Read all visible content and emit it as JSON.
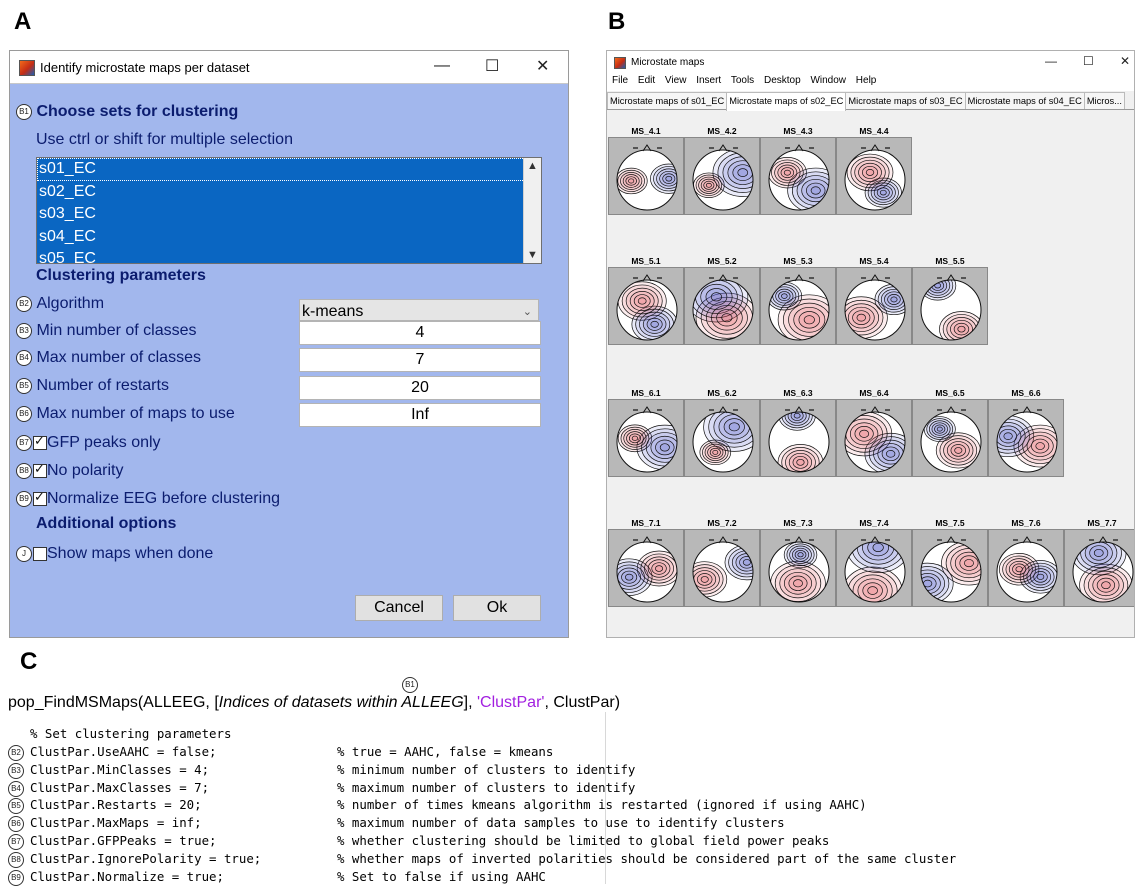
{
  "panels": {
    "a": "A",
    "b": "B",
    "c": "C"
  },
  "dialog_a": {
    "title": "Identify microstate maps per dataset",
    "window_buttons": {
      "minimize": "—",
      "maximize": "☐",
      "close": "✕"
    },
    "choose_sets_heading": "Choose sets for clustering",
    "choose_sets_badge": "B1",
    "hint": "Use ctrl or shift for multiple selection",
    "datasets": [
      "s01_EC",
      "s02_EC",
      "s03_EC",
      "s04_EC",
      "s05_EC"
    ],
    "clustering_heading": "Clustering parameters",
    "algorithm": {
      "badge": "B2",
      "label": "Algorithm",
      "value": "k-means"
    },
    "min_classes": {
      "badge": "B3",
      "label": "Min number of classes",
      "value": "4"
    },
    "max_classes": {
      "badge": "B4",
      "label": "Max number of classes",
      "value": "7"
    },
    "restarts": {
      "badge": "B5",
      "label": "Number of restarts",
      "value": "20"
    },
    "max_maps": {
      "badge": "B6",
      "label": "Max number of maps to use",
      "value": "Inf"
    },
    "gfp_peaks": {
      "badge": "B7",
      "label": "GFP peaks only",
      "checked": true
    },
    "no_polarity": {
      "badge": "B8",
      "label": "No polarity",
      "checked": true
    },
    "normalize": {
      "badge": "B9",
      "label": "Normalize EEG before clustering",
      "checked": true
    },
    "additional_heading": "Additional options",
    "show_maps": {
      "badge": "J",
      "label": "Show maps when done",
      "checked": false
    },
    "cancel_label": "Cancel",
    "ok_label": "Ok"
  },
  "window_b": {
    "title": "Microstate maps",
    "window_buttons": {
      "minimize": "—",
      "maximize": "☐",
      "close": "✕"
    },
    "menu": [
      "File",
      "Edit",
      "View",
      "Insert",
      "Tools",
      "Desktop",
      "Window",
      "Help"
    ],
    "tabs": [
      "Microstate maps of s01_EC",
      "Microstate maps of s02_EC",
      "Microstate maps of s03_EC",
      "Microstate maps of s04_EC",
      "Micros..."
    ],
    "active_tab": 1,
    "rows": [
      {
        "maps": [
          "MS_4.1",
          "MS_4.2",
          "MS_4.3",
          "MS_4.4"
        ]
      },
      {
        "maps": [
          "MS_5.1",
          "MS_5.2",
          "MS_5.3",
          "MS_5.4",
          "MS_5.5"
        ]
      },
      {
        "maps": [
          "MS_6.1",
          "MS_6.2",
          "MS_6.3",
          "MS_6.4",
          "MS_6.5",
          "MS_6.6"
        ]
      },
      {
        "maps": [
          "MS_7.1",
          "MS_7.2",
          "MS_7.3",
          "MS_7.4",
          "MS_7.5",
          "MS_7.6",
          "MS_7.7"
        ]
      }
    ],
    "colors": {
      "positive": "#e0555e",
      "negative": "#4a55c8",
      "background": "#b8b8b8"
    }
  },
  "code": {
    "sig_badge": "B1",
    "sig_prefix": "pop_FindMSMaps(ALLEEG, [",
    "sig_italic": "Indices of datasets within ALLEEG",
    "sig_mid": "], ",
    "sig_string": "'ClustPar'",
    "sig_suffix": ", ClustPar)",
    "header_comment": "% Set clustering parameters",
    "lines": [
      {
        "badge": "B2",
        "code": "ClustPar.UseAAHC = false;",
        "comment": "% true = AAHC, false = kmeans"
      },
      {
        "badge": "B3",
        "code": "ClustPar.MinClasses = 4;",
        "comment": "% minimum number of clusters to identify"
      },
      {
        "badge": "B4",
        "code": "ClustPar.MaxClasses = 7;",
        "comment": "% maximum number of clusters to identify"
      },
      {
        "badge": "B5",
        "code": "ClustPar.Restarts = 20;",
        "comment": "% number of times kmeans algorithm is restarted (ignored if using AAHC)"
      },
      {
        "badge": "B6",
        "code": "ClustPar.MaxMaps = inf;",
        "comment": "% maximum number of data samples to use to identify clusters"
      },
      {
        "badge": "B7",
        "code": "ClustPar.GFPPeaks = true;",
        "comment": "% whether clustering should be limited to global field power peaks"
      },
      {
        "badge": "B8",
        "code": "ClustPar.IgnorePolarity = true;",
        "comment": "% whether maps of inverted polarities should be considered part of the same cluster"
      },
      {
        "badge": "B9",
        "code": "ClustPar.Normalize = true;",
        "comment": "% Set to false if using AAHC"
      }
    ]
  }
}
